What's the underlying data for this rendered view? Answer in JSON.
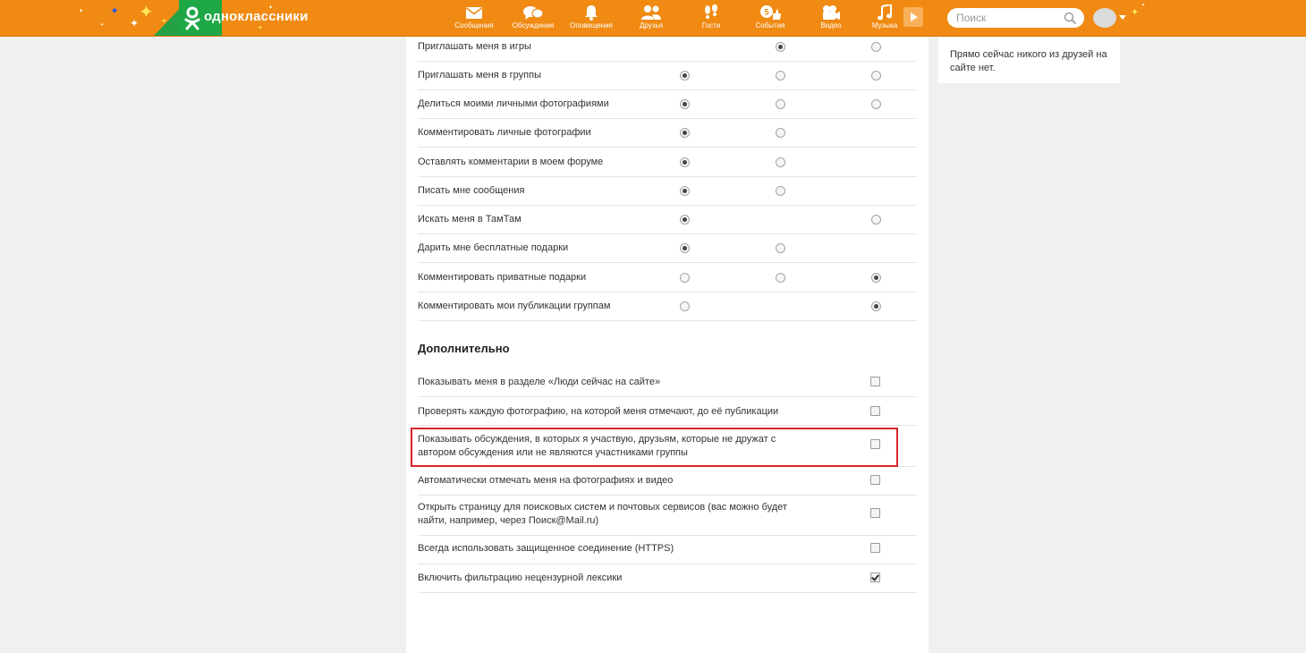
{
  "header": {
    "logo_text": "одноклассники",
    "nav": [
      {
        "label": "Сообщения",
        "icon": "envelope-icon"
      },
      {
        "label": "Обсуждения",
        "icon": "chat-bubbles-icon"
      },
      {
        "label": "Оповещения",
        "icon": "bell-icon"
      },
      {
        "label": "Друзья",
        "icon": "friends-icon"
      },
      {
        "label": "Гости",
        "icon": "footprints-icon"
      },
      {
        "label": "События",
        "icon": "events-icon"
      },
      {
        "label": "Видео",
        "icon": "video-camera-icon"
      },
      {
        "label": "Музыка",
        "icon": "music-note-icon"
      }
    ],
    "search_placeholder": "Поиск",
    "brand_color": "#f08a13"
  },
  "privacy": {
    "rows": [
      {
        "label": "Приглашать меня в игры",
        "options": [
          null,
          true,
          false
        ]
      },
      {
        "label": "Приглашать меня в группы",
        "options": [
          true,
          false,
          false
        ]
      },
      {
        "label": "Делиться моими личными фотографиями",
        "options": [
          true,
          false,
          false
        ]
      },
      {
        "label": "Комментировать личные фотографии",
        "options": [
          true,
          false,
          null
        ]
      },
      {
        "label": "Оставлять комментарии в моем форуме",
        "options": [
          true,
          false,
          null
        ]
      },
      {
        "label": "Писать мне сообщения",
        "options": [
          true,
          false,
          null
        ]
      },
      {
        "label": "Искать меня в ТамТам",
        "options": [
          true,
          null,
          false
        ]
      },
      {
        "label": "Дарить мне бесплатные подарки",
        "options": [
          true,
          false,
          null
        ]
      },
      {
        "label": "Комментировать приватные подарки",
        "options": [
          false,
          false,
          true
        ]
      },
      {
        "label": "Комментировать мои публикации группам",
        "options": [
          false,
          null,
          true
        ]
      }
    ]
  },
  "additional": {
    "title": "Дополнительно",
    "items": [
      {
        "label": "Показывать меня в разделе «Люди сейчас на сайте»",
        "checked": false
      },
      {
        "label": "Проверять каждую фотографию, на которой меня отмечают, до её публикации",
        "checked": false
      },
      {
        "label": "Показывать обсуждения, в которых я участвую, друзьям, которые не дружат с автором обсуждения или не являются участниками группы",
        "checked": false
      },
      {
        "label": "Автоматически отмечать меня на фотографиях и видео",
        "checked": false
      },
      {
        "label": "Открыть страницу для поисковых систем и почтовых сервисов (вас можно будет найти, например, через Поиск@Mail.ru)",
        "checked": false
      },
      {
        "label": "Всегда использовать защищенное соединение (HTTPS)",
        "checked": false
      },
      {
        "label": "Включить фильтрацию нецензурной лексики",
        "checked": true
      }
    ]
  },
  "sidebar": {
    "friends_online_text": "Прямо сейчас никого из друзей на сайте нет."
  }
}
